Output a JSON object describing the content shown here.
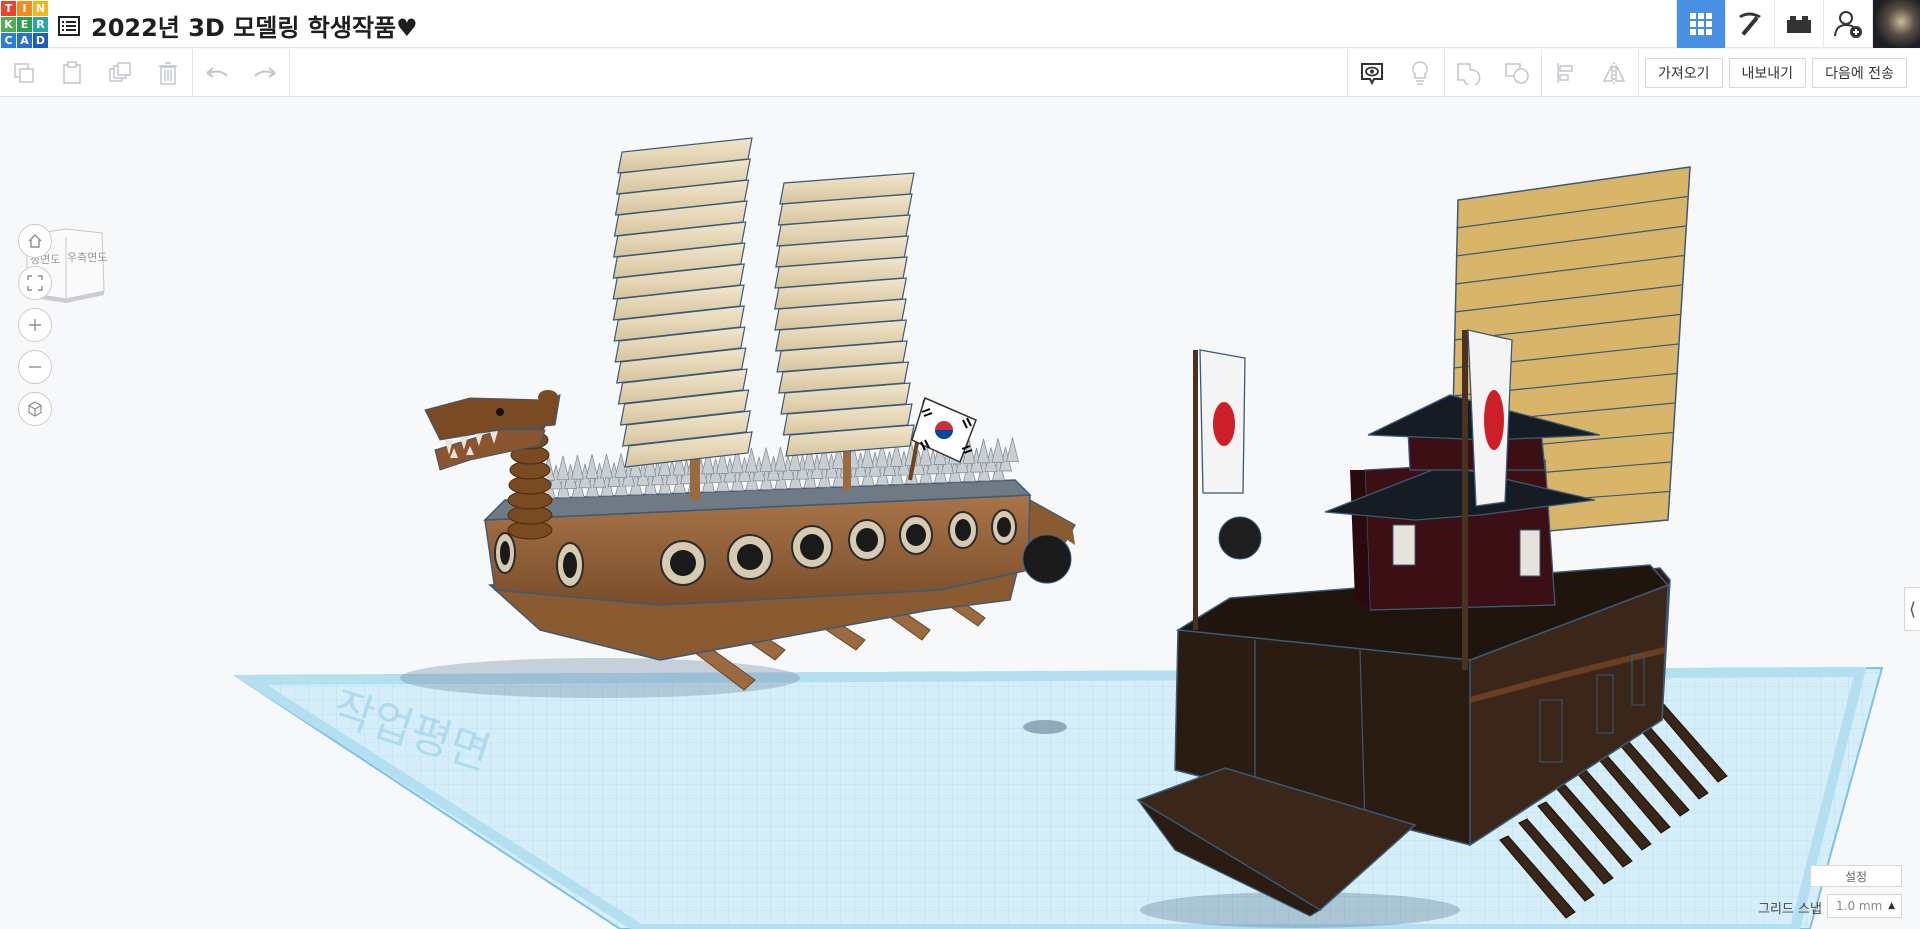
{
  "app": {
    "logo_letters": [
      "T",
      "I",
      "N",
      "K",
      "E",
      "R",
      "C",
      "A",
      "D"
    ],
    "logo_colors": [
      "#e8442e",
      "#f58b1f",
      "#f5b31c",
      "#4caf50",
      "#2d9e4e",
      "#26a6a0",
      "#2b7fd3",
      "#2b6fcf",
      "#1d5fb8"
    ]
  },
  "header": {
    "title": "2022년 3D 모델링 학생작품♥",
    "right_buttons": [
      {
        "name": "3d-design-view",
        "icon": "grid-icon",
        "active": true
      },
      {
        "name": "codeblocks",
        "icon": "pickaxe-icon",
        "active": false
      },
      {
        "name": "bricks",
        "icon": "brick-icon",
        "active": false
      },
      {
        "name": "invite",
        "icon": "add-user-icon",
        "active": false
      }
    ]
  },
  "toolbar": {
    "import_label": "가져오기",
    "export_label": "내보내기",
    "send_to_label": "다음에 전송"
  },
  "viewcube": {
    "front_label": "정면도",
    "right_label": "우측면도"
  },
  "workplane": {
    "plane_text": "작업평면"
  },
  "bottom": {
    "settings_label": "설정",
    "snap_label": "그리드 스냅",
    "snap_value": "1.0 mm"
  },
  "colors": {
    "accent": "#4a90e2",
    "grid_blue": "#bfe3f4",
    "turtle_wood": "#9a6a3e",
    "sail_beige": "#e6d8b8",
    "japan_hull": "#2e1f14",
    "japan_sail": "#d9b56a"
  }
}
